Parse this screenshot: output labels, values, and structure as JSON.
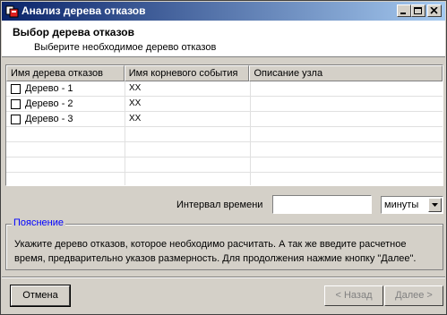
{
  "window": {
    "title": "Анализ дерева отказов"
  },
  "header": {
    "title": "Выбор дерева отказов",
    "subtitle": "Выберите необходимое дерево отказов"
  },
  "table": {
    "columns": [
      "Имя дерева отказов",
      "Имя корневого события",
      "Описание узла"
    ],
    "rows": [
      {
        "checked": false,
        "name": "Дерево - 1",
        "root": "XX",
        "description": ""
      },
      {
        "checked": false,
        "name": "Дерево - 2",
        "root": "XX",
        "description": ""
      },
      {
        "checked": false,
        "name": "Дерево - 3",
        "root": "XX",
        "description": ""
      }
    ]
  },
  "interval": {
    "label": "Интервал времени",
    "value": "",
    "unit": "минуты"
  },
  "explanation": {
    "title": "Пояснение",
    "line1": "Укажите дерево отказов, которое необходимо расчитать. А так же введите расчетное",
    "line2": "время, предварительно указов размерность. Для продолжения нажмие кнопку \"Далее\"."
  },
  "buttons": {
    "cancel": "Отмена",
    "back": "< Назад",
    "next": "Далее >"
  }
}
